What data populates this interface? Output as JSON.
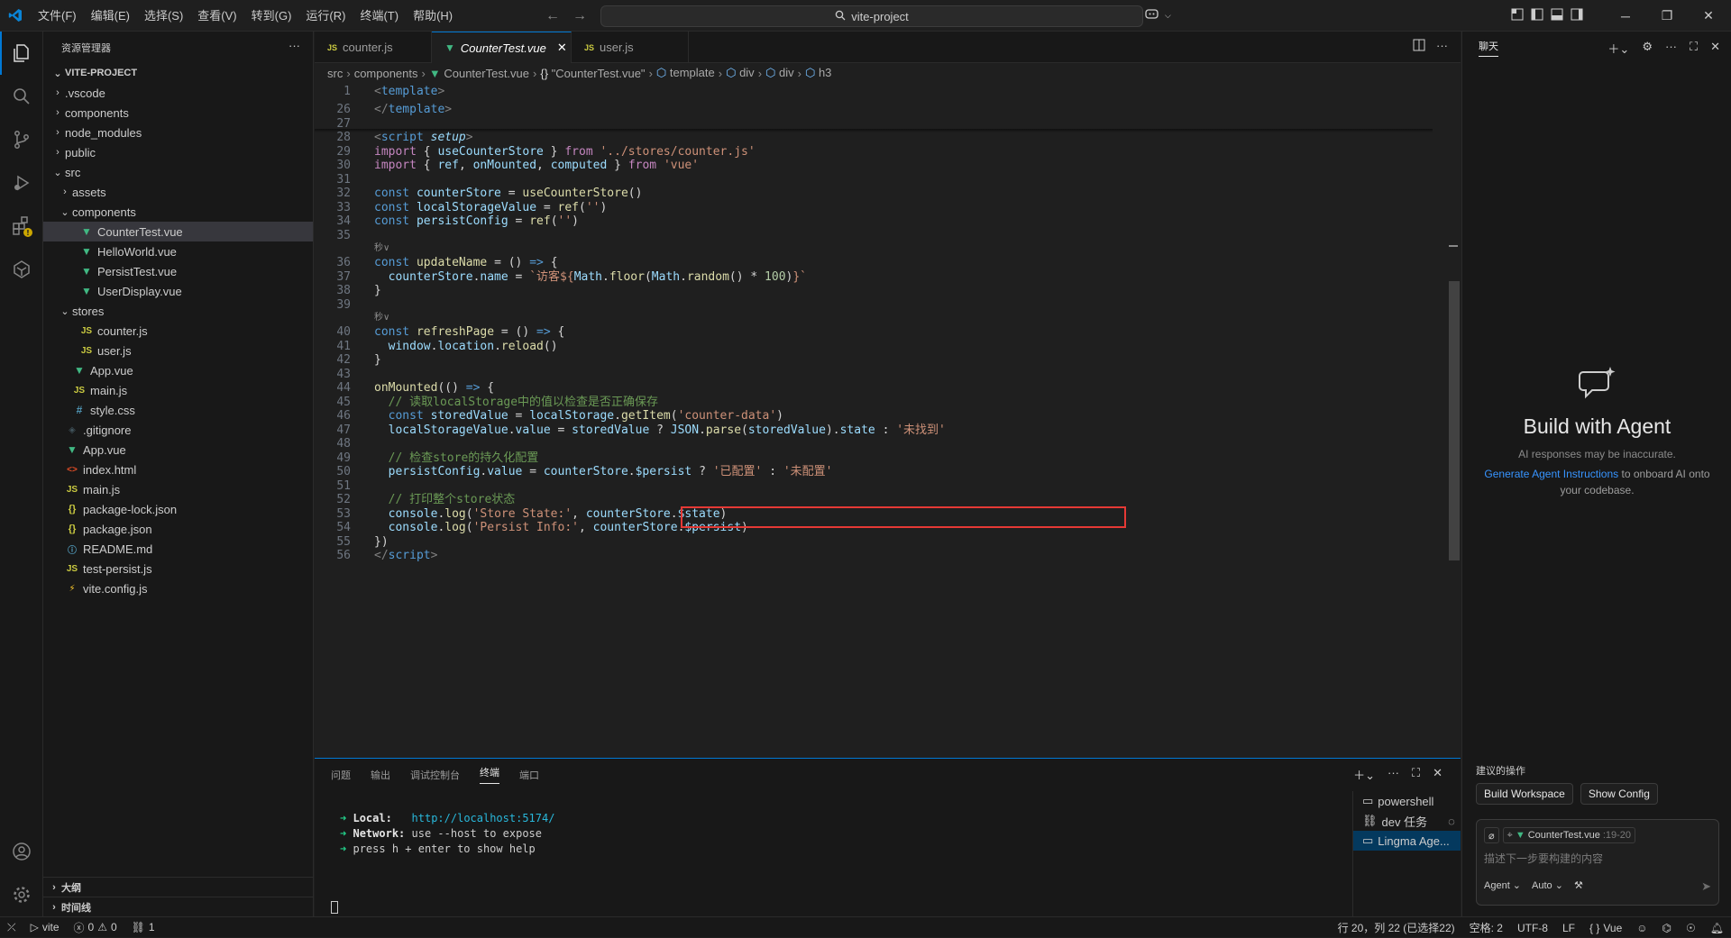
{
  "titlebar": {
    "menus": [
      "文件(F)",
      "编辑(E)",
      "选择(S)",
      "查看(V)",
      "转到(G)",
      "运行(R)",
      "终端(T)",
      "帮助(H)"
    ],
    "search_text": "vite-project"
  },
  "sidebar": {
    "header": "资源管理器",
    "project": "VITE-PROJECT",
    "tree": [
      {
        "label": ".vscode",
        "type": "folder",
        "depth": 0,
        "open": false
      },
      {
        "label": "components",
        "type": "folder",
        "depth": 0,
        "open": false
      },
      {
        "label": "node_modules",
        "type": "folder",
        "depth": 0,
        "open": false
      },
      {
        "label": "public",
        "type": "folder",
        "depth": 0,
        "open": false
      },
      {
        "label": "src",
        "type": "folder",
        "depth": 0,
        "open": true
      },
      {
        "label": "assets",
        "type": "folder",
        "depth": 1,
        "open": false
      },
      {
        "label": "components",
        "type": "folder",
        "depth": 1,
        "open": true
      },
      {
        "label": "CounterTest.vue",
        "type": "vue",
        "depth": 2,
        "selected": true
      },
      {
        "label": "HelloWorld.vue",
        "type": "vue",
        "depth": 2
      },
      {
        "label": "PersistTest.vue",
        "type": "vue",
        "depth": 2
      },
      {
        "label": "UserDisplay.vue",
        "type": "vue",
        "depth": 2
      },
      {
        "label": "stores",
        "type": "folder",
        "depth": 1,
        "open": true
      },
      {
        "label": "counter.js",
        "type": "js",
        "depth": 2
      },
      {
        "label": "user.js",
        "type": "js",
        "depth": 2
      },
      {
        "label": "App.vue",
        "type": "vue",
        "depth": 1
      },
      {
        "label": "main.js",
        "type": "js",
        "depth": 1
      },
      {
        "label": "style.css",
        "type": "css",
        "depth": 1
      },
      {
        "label": ".gitignore",
        "type": "git",
        "depth": 0
      },
      {
        "label": "App.vue",
        "type": "vue",
        "depth": 0
      },
      {
        "label": "index.html",
        "type": "html",
        "depth": 0
      },
      {
        "label": "main.js",
        "type": "js",
        "depth": 0
      },
      {
        "label": "package-lock.json",
        "type": "json",
        "depth": 0
      },
      {
        "label": "package.json",
        "type": "json",
        "depth": 0
      },
      {
        "label": "README.md",
        "type": "md",
        "depth": 0
      },
      {
        "label": "test-persist.js",
        "type": "js",
        "depth": 0
      },
      {
        "label": "vite.config.js",
        "type": "vite",
        "depth": 0
      }
    ],
    "outline": "大纲",
    "timeline": "时间线"
  },
  "tabs": [
    {
      "label": "counter.js",
      "type": "js"
    },
    {
      "label": "CounterTest.vue",
      "type": "vue",
      "active": true
    },
    {
      "label": "user.js",
      "type": "js"
    }
  ],
  "breadcrumbs": [
    "src",
    "components",
    "CounterTest.vue",
    "\"CounterTest.vue\"",
    "template",
    "div",
    "div",
    "h3"
  ],
  "code": {
    "codelens": "秒∨",
    "lines": [
      {
        "n": "1",
        "html": "<span class='punc'>&lt;</span><span class='tag'>template</span><span class='punc'>&gt;</span>"
      },
      {
        "n": "26",
        "html": "<span class='punc'>&lt;/</span><span class='tag'>template</span><span class='punc'>&gt;</span>"
      },
      {
        "n": "27",
        "html": ""
      },
      {
        "n": "28",
        "html": "<span class='punc'>&lt;</span><span class='tag'>script</span> <span class='attr'>setup</span><span class='punc'>&gt;</span>"
      },
      {
        "n": "29",
        "html": "<span class='ctl'>import</span> <span class='plain'>{ </span><span class='var'>useCounterStore</span><span class='plain'> } </span><span class='ctl'>from</span> <span class='str'>'../stores/counter.js'</span>"
      },
      {
        "n": "30",
        "html": "<span class='ctl'>import</span> <span class='plain'>{ </span><span class='var'>ref</span><span class='plain'>, </span><span class='var'>onMounted</span><span class='plain'>, </span><span class='var'>computed</span><span class='plain'> } </span><span class='ctl'>from</span> <span class='str'>'vue'</span>"
      },
      {
        "n": "31",
        "html": ""
      },
      {
        "n": "32",
        "html": "<span class='kw'>const</span> <span class='var'>counterStore</span> <span class='plain'>= </span><span class='fn'>useCounterStore</span><span class='plain'>()</span>"
      },
      {
        "n": "33",
        "html": "<span class='kw'>const</span> <span class='var'>localStorageValue</span> <span class='plain'>= </span><span class='fn'>ref</span><span class='plain'>(</span><span class='str'>''</span><span class='plain'>)</span>"
      },
      {
        "n": "34",
        "html": "<span class='kw'>const</span> <span class='var'>persistConfig</span> <span class='plain'>= </span><span class='fn'>ref</span><span class='plain'>(</span><span class='str'>''</span><span class='plain'>)</span>"
      },
      {
        "n": "35",
        "html": ""
      },
      {
        "n": "36",
        "html": "<span class='kw'>const</span> <span class='fn'>updateName</span> <span class='plain'>= () </span><span class='kw'>=&gt;</span><span class='plain'> {</span>",
        "lens": true
      },
      {
        "n": "37",
        "html": "  <span class='var'>counterStore</span><span class='plain'>.</span><span class='var'>name</span> <span class='plain'>= </span><span class='str'>`访客${</span><span class='var'>Math</span><span class='plain'>.</span><span class='fn'>floor</span><span class='plain'>(</span><span class='var'>Math</span><span class='plain'>.</span><span class='fn'>random</span><span class='plain'>() * </span><span class='num'>100</span><span class='plain'>)</span><span class='str'>}`</span>"
      },
      {
        "n": "38",
        "html": "<span class='plain'>}</span>"
      },
      {
        "n": "39",
        "html": ""
      },
      {
        "n": "40",
        "html": "<span class='kw'>const</span> <span class='fn'>refreshPage</span> <span class='plain'>= () </span><span class='kw'>=&gt;</span><span class='plain'> {</span>",
        "lens": true
      },
      {
        "n": "41",
        "html": "  <span class='var'>window</span><span class='plain'>.</span><span class='var'>location</span><span class='plain'>.</span><span class='fn'>reload</span><span class='plain'>()</span>"
      },
      {
        "n": "42",
        "html": "<span class='plain'>}</span>"
      },
      {
        "n": "43",
        "html": ""
      },
      {
        "n": "44",
        "html": "<span class='fn'>onMounted</span><span class='plain'>(() </span><span class='kw'>=&gt;</span><span class='plain'> {</span>"
      },
      {
        "n": "45",
        "html": "  <span class='cmt'>// 读取localStorage中的值以检查是否正确保存</span>"
      },
      {
        "n": "46",
        "html": "  <span class='kw'>const</span> <span class='var'>storedValue</span> <span class='plain'>= </span><span class='var'>localStorage</span><span class='plain'>.</span><span class='fn'>getItem</span><span class='plain'>(</span><span class='str'>'counter-data'</span><span class='plain'>)</span>"
      },
      {
        "n": "47",
        "html": "  <span class='var'>localStorageValue</span><span class='plain'>.</span><span class='var'>value</span> <span class='plain'>= </span><span class='var'>storedValue</span> <span class='plain'>? </span><span class='var'>JSON</span><span class='plain'>.</span><span class='fn'>parse</span><span class='plain'>(</span><span class='var'>storedValue</span><span class='plain'>).</span><span class='var'>state</span> <span class='plain'>: </span><span class='str'>'未找到'</span>"
      },
      {
        "n": "48",
        "html": ""
      },
      {
        "n": "49",
        "html": "  <span class='cmt'>// 检查store的持久化配置</span>"
      },
      {
        "n": "50",
        "html": "  <span class='var'>persistConfig</span><span class='plain'>.</span><span class='var'>value</span> <span class='plain'>= </span><span class='var'>counterStore</span><span class='plain'>.</span><span class='var'>$persist</span> <span class='plain'>? </span><span class='str'>'已配置'</span> <span class='plain'>: </span><span class='str'>'未配置'</span>"
      },
      {
        "n": "51",
        "html": ""
      },
      {
        "n": "52",
        "html": "  <span class='cmt'>// 打印整个store状态</span>"
      },
      {
        "n": "53",
        "html": "  <span class='var'>console</span><span class='plain'>.</span><span class='fn'>log</span><span class='plain'>(</span><span class='str'>'Store State:'</span><span class='plain'>, </span><span class='var'>counterStore</span><span class='plain'>.</span><span class='var'>$state</span><span class='plain'>)</span>"
      },
      {
        "n": "54",
        "html": "  <span class='var'>console</span><span class='plain'>.</span><span class='fn'>log</span><span class='plain'>(</span><span class='str'>'Persist Info:'</span><span class='plain'>, </span><span class='var'>counterStore</span><span class='plain'>.</span><span class='var'>$persist</span><span class='plain'>)</span>"
      },
      {
        "n": "55",
        "html": "<span class='plain'>})</span>"
      },
      {
        "n": "56",
        "html": "<span class='punc'>&lt;/</span><span class='tag'>script</span><span class='punc'>&gt;</span>"
      }
    ]
  },
  "panel": {
    "tabs": [
      "问题",
      "输出",
      "调试控制台",
      "终端",
      "端口"
    ],
    "active_tab": "终端",
    "terminal": {
      "local_label": "Local:",
      "local_url": "http://localhost:5174/",
      "network_label": "Network:",
      "network_text": "use --host to expose",
      "help_text": "press h + enter to show help",
      "arrow": "➜"
    },
    "terminals": [
      "powershell",
      "dev 任务",
      "Lingma Age..."
    ]
  },
  "chat": {
    "header": "聊天",
    "title": "Build with Agent",
    "subtitle": "AI responses may be inaccurate.",
    "link": "Generate Agent Instructions",
    "hint": "to onboard AI onto your codebase.",
    "suggest_label": "建议的操作",
    "buttons": [
      "Build Workspace",
      "Show Config"
    ],
    "context_file": "CounterTest.vue",
    "context_range": ":19-20",
    "placeholder": "描述下一步要构建的内容",
    "mode": "Agent",
    "model": "Auto"
  },
  "statusbar": {
    "remote": "vite",
    "errors": "0",
    "warnings": "0",
    "ports": "1",
    "position": "行 20，列 22 (已选择22)",
    "spaces": "空格: 2",
    "encoding": "UTF-8",
    "eol": "LF",
    "language": "Vue"
  },
  "colors": {
    "accent": "#0078d4",
    "highlight_box": "#e53935",
    "vue": "#41b883"
  }
}
